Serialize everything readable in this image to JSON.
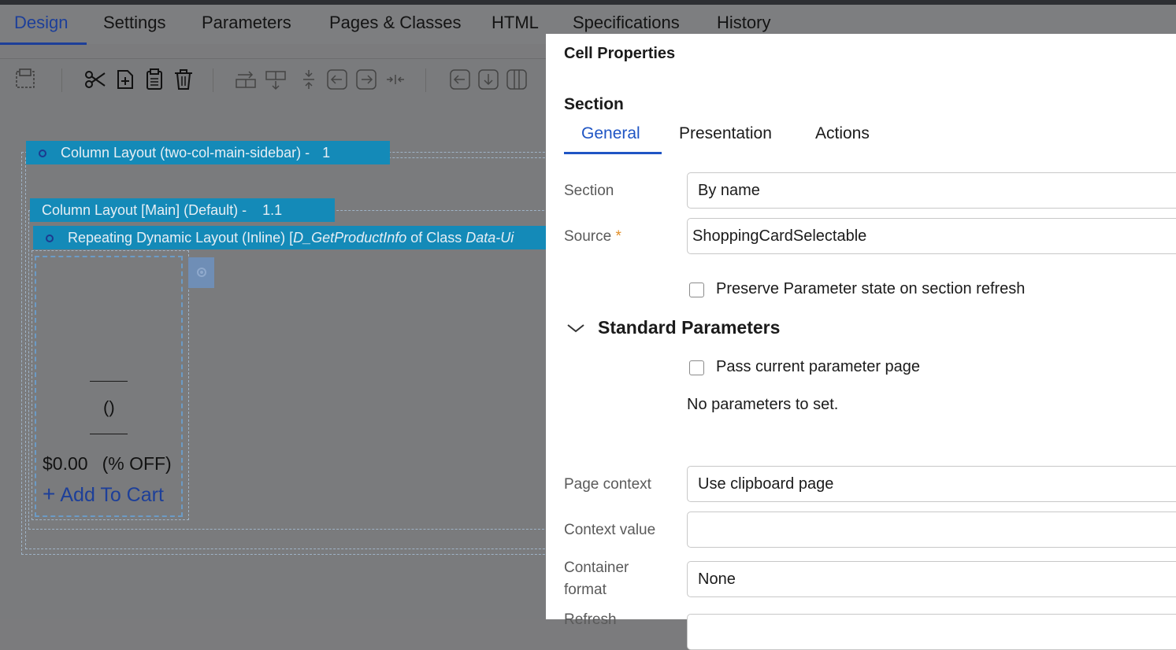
{
  "tabs": [
    "Design",
    "Settings",
    "Parameters",
    "Pages & Classes",
    "HTML",
    "Specifications",
    "History"
  ],
  "active_tab": "Design",
  "toolbar": {
    "icons": [
      "layout-select-icon",
      "cut-icon",
      "add-page-icon",
      "clipboard-icon",
      "delete-icon",
      "insert-row-after-icon",
      "insert-row-before-icon",
      "row-resize-icon",
      "insert-left-icon",
      "insert-right-icon",
      "merge-icon",
      "column-left-icon",
      "column-down-icon",
      "column-icon"
    ]
  },
  "canvas": {
    "layout1": {
      "label": "Column Layout (two-col-main-sidebar) -",
      "num": "1"
    },
    "layout2": {
      "label": "Column Layout [Main] (Default) -",
      "num": "1.1"
    },
    "layout3": {
      "prefix": "Repeating Dynamic Layout (Inline) [",
      "source": "D_GetProductInfo",
      "middle": " of Class ",
      "class": "Data-Ui"
    },
    "card": {
      "parens": "()",
      "price": "$0.00",
      "discount": "(% OFF)",
      "add_to_cart": "Add To Cart"
    }
  },
  "panel": {
    "title": "Cell Properties",
    "section_heading": "Section",
    "tabs": [
      "General",
      "Presentation",
      "Actions"
    ],
    "active_tab": "General",
    "fields": {
      "section_label": "Section",
      "section_value": "By name",
      "source_label": "Source",
      "source_required": "*",
      "source_value": "ShoppingCardSelectable",
      "preserve_label": "Preserve Parameter state on section refresh",
      "preserve_checked": false,
      "standard_params": "Standard Parameters",
      "pass_param_label": "Pass current parameter page",
      "pass_param_checked": false,
      "no_params": "No parameters to set.",
      "page_context_label": "Page context",
      "page_context_value": "Use clipboard page",
      "context_value_label": "Context value",
      "context_value_value": "",
      "container_format_label_1": "Container",
      "container_format_label_2": "format",
      "container_format_value": "None",
      "refresh_label": "Refresh"
    }
  },
  "colors": {
    "accent_blue": "#1f55c4",
    "layout_header": "#148ab8",
    "required_star": "#e2902a",
    "overlay": "#7b7b7d"
  }
}
